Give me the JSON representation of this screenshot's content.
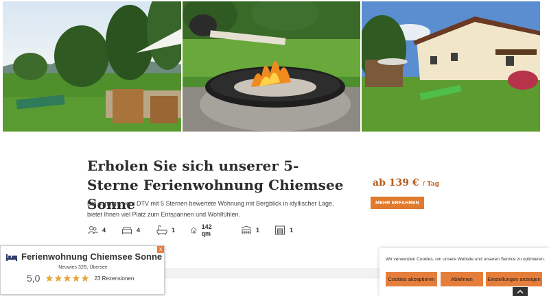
{
  "hero": {
    "title": "Erholen Sie sich unserer 5-Sterne Ferienwohnung Chiemsee Sonne",
    "description": "Die sonnige, vom DTV mit 5 Sternen bewertete Wohnung mit Bergblick in idyllischer Lage, bietet Ihnen viel Platz zum Entspannen und Wohlfühlen.",
    "price": "ab 139 €",
    "price_unit": "/ Tag",
    "more_label": "MEHR ERFAHREN"
  },
  "features": [
    {
      "icon": "guests-icon",
      "value": "4"
    },
    {
      "icon": "bed-icon",
      "value": "4"
    },
    {
      "icon": "bathtub-icon",
      "value": "1"
    },
    {
      "icon": "house-icon",
      "value": "142 qm"
    },
    {
      "icon": "terrace-icon",
      "value": "1"
    },
    {
      "icon": "garage-icon",
      "value": "1"
    }
  ],
  "review_widget": {
    "name": "Ferienwohnung Chiemsee Sonne",
    "address": "Neuwies 32B, Übersee",
    "score": "5,0",
    "stars": 5,
    "count": "23 Rezensionen",
    "close": "x"
  },
  "cookie": {
    "text": "Wir verwenden Cookies, um unsere Website und unseren Service zu optimieren.",
    "accept": "Cookies akzeptieren",
    "deny": "Ablehnen",
    "settings": "Einstellungen anzeigen"
  },
  "colors": {
    "accent": "#e07a2e",
    "price": "#b75c1d",
    "star": "#e5a93c"
  }
}
